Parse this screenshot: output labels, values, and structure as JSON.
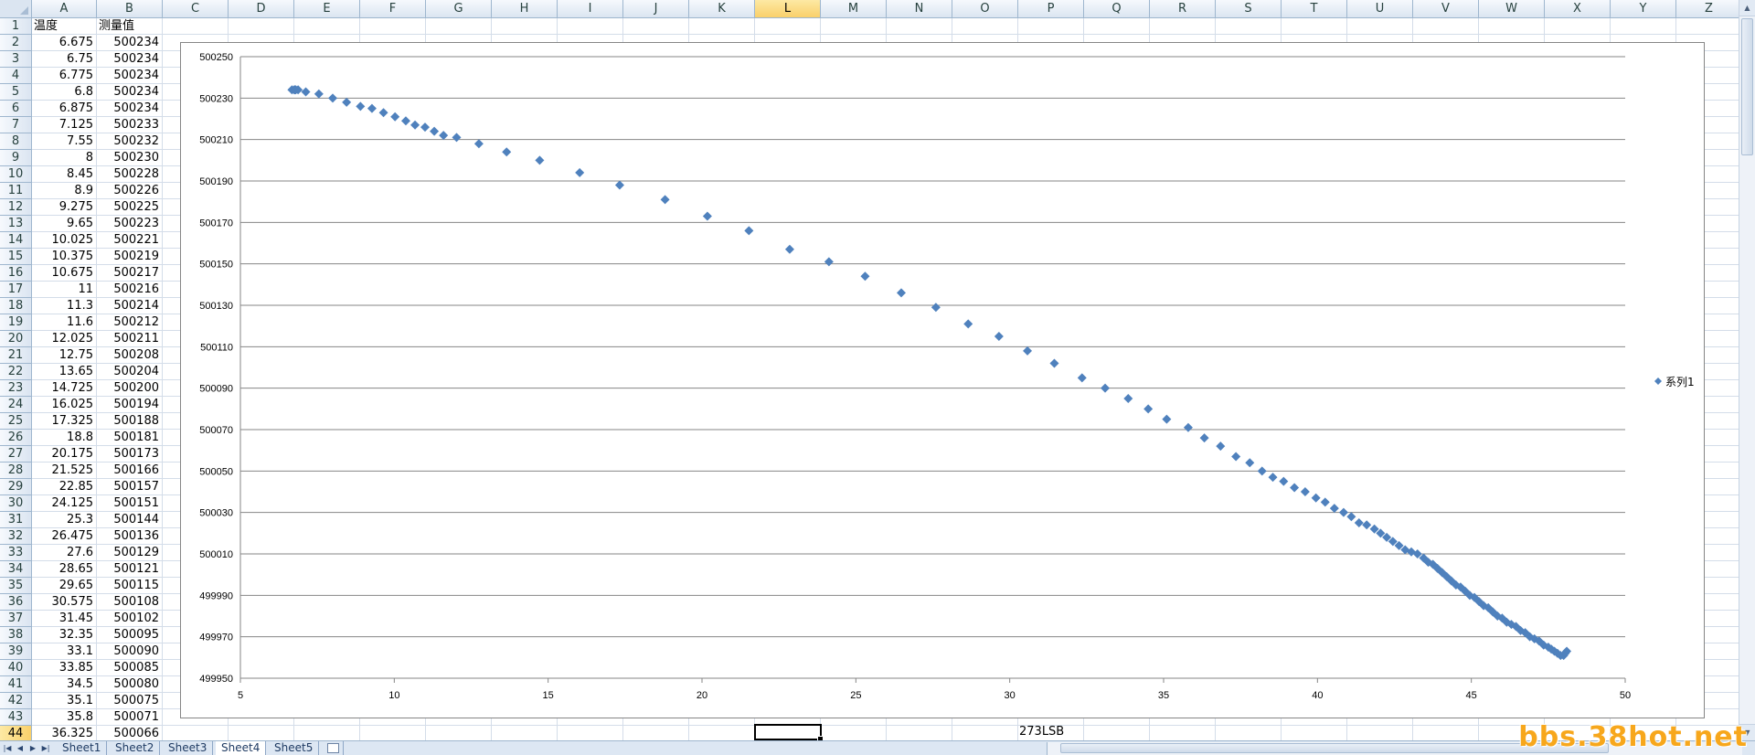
{
  "columns": [
    "A",
    "B",
    "C",
    "D",
    "E",
    "F",
    "G",
    "H",
    "I",
    "J",
    "K",
    "L",
    "M",
    "N",
    "O",
    "P",
    "Q",
    "R",
    "S",
    "T",
    "U",
    "V",
    "W",
    "X",
    "Y",
    "Z"
  ],
  "selected_column": "L",
  "selected_row": 44,
  "rows": [
    {
      "row": 1,
      "a": "温度",
      "b": "测量值"
    },
    {
      "row": 2,
      "a": "6.675",
      "b": "500234"
    },
    {
      "row": 3,
      "a": "6.75",
      "b": "500234"
    },
    {
      "row": 4,
      "a": "6.775",
      "b": "500234"
    },
    {
      "row": 5,
      "a": "6.8",
      "b": "500234"
    },
    {
      "row": 6,
      "a": "6.875",
      "b": "500234"
    },
    {
      "row": 7,
      "a": "7.125",
      "b": "500233"
    },
    {
      "row": 8,
      "a": "7.55",
      "b": "500232"
    },
    {
      "row": 9,
      "a": "8",
      "b": "500230"
    },
    {
      "row": 10,
      "a": "8.45",
      "b": "500228"
    },
    {
      "row": 11,
      "a": "8.9",
      "b": "500226"
    },
    {
      "row": 12,
      "a": "9.275",
      "b": "500225"
    },
    {
      "row": 13,
      "a": "9.65",
      "b": "500223"
    },
    {
      "row": 14,
      "a": "10.025",
      "b": "500221"
    },
    {
      "row": 15,
      "a": "10.375",
      "b": "500219"
    },
    {
      "row": 16,
      "a": "10.675",
      "b": "500217"
    },
    {
      "row": 17,
      "a": "11",
      "b": "500216"
    },
    {
      "row": 18,
      "a": "11.3",
      "b": "500214"
    },
    {
      "row": 19,
      "a": "11.6",
      "b": "500212"
    },
    {
      "row": 20,
      "a": "12.025",
      "b": "500211"
    },
    {
      "row": 21,
      "a": "12.75",
      "b": "500208"
    },
    {
      "row": 22,
      "a": "13.65",
      "b": "500204"
    },
    {
      "row": 23,
      "a": "14.725",
      "b": "500200"
    },
    {
      "row": 24,
      "a": "16.025",
      "b": "500194"
    },
    {
      "row": 25,
      "a": "17.325",
      "b": "500188"
    },
    {
      "row": 26,
      "a": "18.8",
      "b": "500181"
    },
    {
      "row": 27,
      "a": "20.175",
      "b": "500173"
    },
    {
      "row": 28,
      "a": "21.525",
      "b": "500166"
    },
    {
      "row": 29,
      "a": "22.85",
      "b": "500157"
    },
    {
      "row": 30,
      "a": "24.125",
      "b": "500151"
    },
    {
      "row": 31,
      "a": "25.3",
      "b": "500144"
    },
    {
      "row": 32,
      "a": "26.475",
      "b": "500136"
    },
    {
      "row": 33,
      "a": "27.6",
      "b": "500129"
    },
    {
      "row": 34,
      "a": "28.65",
      "b": "500121"
    },
    {
      "row": 35,
      "a": "29.65",
      "b": "500115"
    },
    {
      "row": 36,
      "a": "30.575",
      "b": "500108"
    },
    {
      "row": 37,
      "a": "31.45",
      "b": "500102"
    },
    {
      "row": 38,
      "a": "32.35",
      "b": "500095"
    },
    {
      "row": 39,
      "a": "33.1",
      "b": "500090"
    },
    {
      "row": 40,
      "a": "33.85",
      "b": "500085"
    },
    {
      "row": 41,
      "a": "34.5",
      "b": "500080"
    },
    {
      "row": 42,
      "a": "35.1",
      "b": "500075"
    },
    {
      "row": 43,
      "a": "35.8",
      "b": "500071"
    },
    {
      "row": 44,
      "a": "36.325",
      "b": "500066"
    }
  ],
  "cell_p44": "273LSB",
  "sheet_tabs": [
    "Sheet1",
    "Sheet2",
    "Sheet3",
    "Sheet4",
    "Sheet5"
  ],
  "active_sheet": "Sheet4",
  "watermark": "bbs.38hot.net",
  "chart_data": {
    "type": "scatter",
    "title": "",
    "xlabel": "",
    "ylabel": "",
    "xlim": [
      5,
      50
    ],
    "ylim": [
      499950,
      500250
    ],
    "xticks": [
      5,
      10,
      15,
      20,
      25,
      30,
      35,
      40,
      45,
      50
    ],
    "yticks": [
      499950,
      499970,
      499990,
      500010,
      500030,
      500050,
      500070,
      500090,
      500110,
      500130,
      500150,
      500170,
      500190,
      500210,
      500230,
      500250
    ],
    "grid": "horizontal",
    "legend": "right",
    "marker_color": "#4f81bd",
    "series": [
      {
        "name": "系列1",
        "x": [
          6.675,
          6.75,
          6.775,
          6.8,
          6.875,
          7.125,
          7.55,
          8,
          8.45,
          8.9,
          9.275,
          9.65,
          10.025,
          10.375,
          10.675,
          11,
          11.3,
          11.6,
          12.025,
          12.75,
          13.65,
          14.725,
          16.025,
          17.325,
          18.8,
          20.175,
          21.525,
          22.85,
          24.125,
          25.3,
          26.475,
          27.6,
          28.65,
          29.65,
          30.575,
          31.45,
          32.35,
          33.1,
          33.85,
          34.5,
          35.1,
          35.8,
          36.325,
          36.85,
          37.35,
          37.8,
          38.2,
          38.55,
          38.9,
          39.25,
          39.6,
          39.95,
          40.25,
          40.55,
          40.85,
          41.1,
          41.35,
          41.6,
          41.85,
          42.05,
          42.25,
          42.45,
          42.65,
          42.85,
          43.05,
          43.25,
          43.45,
          43.6,
          43.75,
          43.9,
          44.05,
          44.2,
          44.35,
          44.5,
          44.65,
          44.8,
          44.95,
          45.1,
          45.25,
          45.4,
          45.55,
          45.7,
          45.85,
          46,
          46.15,
          46.3,
          46.45,
          46.6,
          46.75,
          46.9,
          47.05,
          47.2,
          47.35,
          47.5,
          47.6,
          47.7,
          47.8,
          47.9,
          48,
          48.05,
          48.1
        ],
        "y": [
          500234,
          500234,
          500234,
          500234,
          500234,
          500233,
          500232,
          500230,
          500228,
          500226,
          500225,
          500223,
          500221,
          500219,
          500217,
          500216,
          500214,
          500212,
          500211,
          500208,
          500204,
          500200,
          500194,
          500188,
          500181,
          500173,
          500166,
          500157,
          500151,
          500144,
          500136,
          500129,
          500121,
          500115,
          500108,
          500102,
          500095,
          500090,
          500085,
          500080,
          500075,
          500071,
          500066,
          500062,
          500057,
          500054,
          500050,
          500047,
          500045,
          500042,
          500040,
          500037,
          500035,
          500032,
          500030,
          500028,
          500025,
          500024,
          500022,
          500020,
          500018,
          500016,
          500014,
          500012,
          500011,
          500010,
          500008,
          500006,
          500005,
          500003,
          500001,
          499999,
          499997,
          499995,
          499994,
          499992,
          499990,
          499989,
          499987,
          499985,
          499984,
          499982,
          499980,
          499979,
          499977,
          499976,
          499975,
          499973,
          499972,
          499970,
          499969,
          499968,
          499966,
          499965,
          499964,
          499963,
          499962,
          499961,
          499961,
          499962,
          499963
        ]
      }
    ]
  }
}
